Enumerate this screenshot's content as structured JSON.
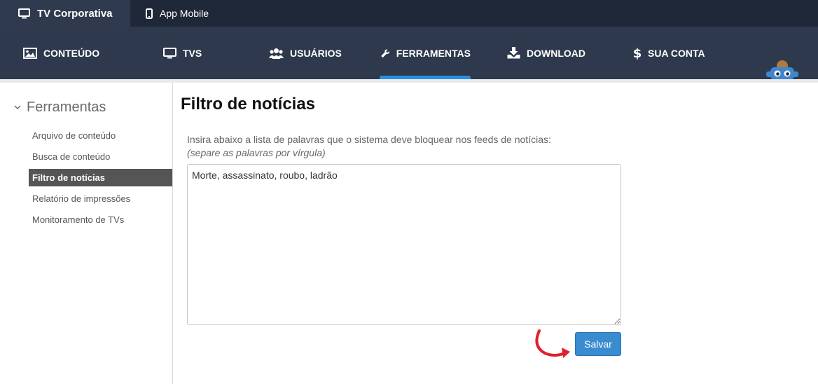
{
  "product_tabs": [
    {
      "label": "TV Corporativa",
      "icon": "monitor-icon",
      "active": true
    },
    {
      "label": "App Mobile",
      "icon": "smartphone-icon",
      "active": false
    }
  ],
  "nav": {
    "items": [
      {
        "label": "CONTEÚDO",
        "icon": "image-icon"
      },
      {
        "label": "TVS",
        "icon": "monitor-icon"
      },
      {
        "label": "USUÁRIOS",
        "icon": "users-icon"
      },
      {
        "label": "FERRAMENTAS",
        "icon": "wrench-icon",
        "active": true
      },
      {
        "label": "DOWNLOAD",
        "icon": "download-icon"
      },
      {
        "label": "SUA CONTA",
        "icon": "dollar-icon"
      }
    ],
    "accent": "#2a8ee6"
  },
  "sidebar": {
    "title": "Ferramentas",
    "items": [
      {
        "label": "Arquivo de conteúdo"
      },
      {
        "label": "Busca de conteúdo"
      },
      {
        "label": "Filtro de notícias",
        "active": true
      },
      {
        "label": "Relatório de impressões"
      },
      {
        "label": "Monitoramento de TVs"
      }
    ]
  },
  "main": {
    "title": "Filtro de notícias",
    "instruction": "Insira abaixo a lista de palavras que o sistema deve bloquear nos feeds de notícias:",
    "hint": "(separe as palavras por vírgula)",
    "words_value": "Morte, assassinato, roubo, ladrão",
    "save_label": "Salvar"
  },
  "colors": {
    "topbar_bg": "#1f2838",
    "nav_bg": "#2e394d",
    "button_bg": "#3a8cd1",
    "annotation_arrow": "#e0202a"
  }
}
